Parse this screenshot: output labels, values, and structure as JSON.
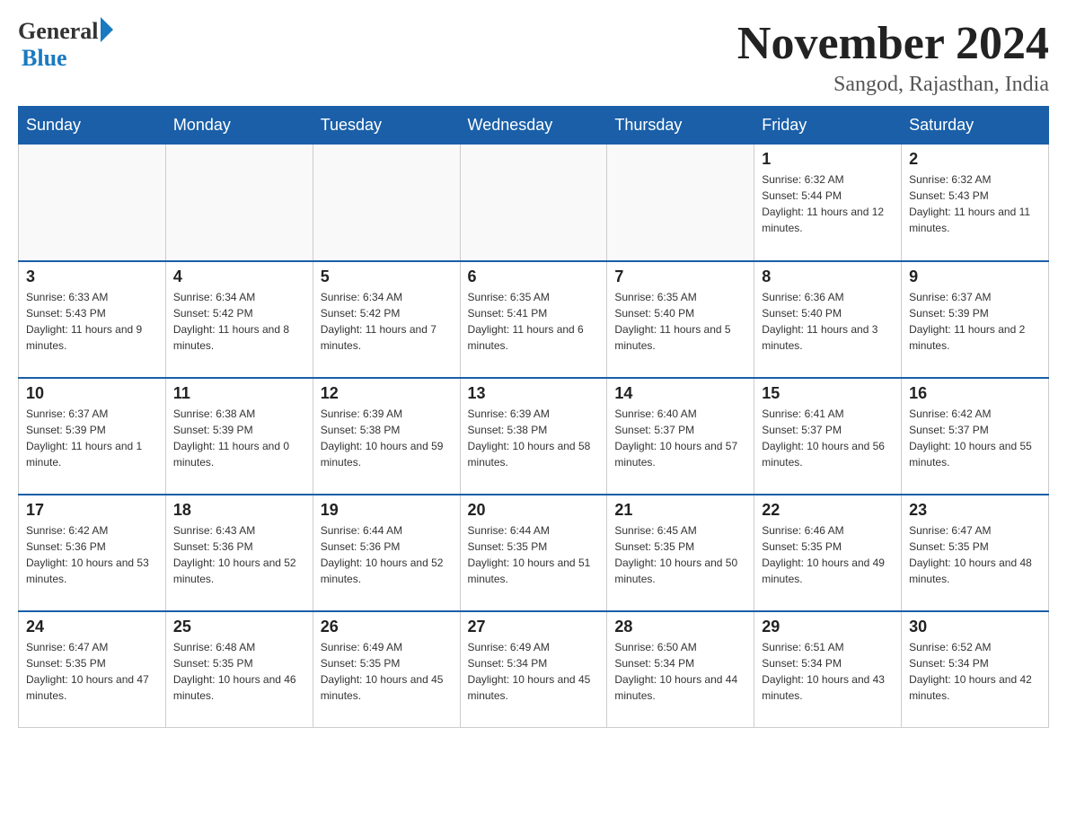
{
  "header": {
    "logo": {
      "general": "General",
      "blue": "Blue"
    },
    "title": "November 2024",
    "location": "Sangod, Rajasthan, India"
  },
  "days_of_week": [
    "Sunday",
    "Monday",
    "Tuesday",
    "Wednesday",
    "Thursday",
    "Friday",
    "Saturday"
  ],
  "weeks": [
    [
      {
        "day": "",
        "info": ""
      },
      {
        "day": "",
        "info": ""
      },
      {
        "day": "",
        "info": ""
      },
      {
        "day": "",
        "info": ""
      },
      {
        "day": "",
        "info": ""
      },
      {
        "day": "1",
        "info": "Sunrise: 6:32 AM\nSunset: 5:44 PM\nDaylight: 11 hours and 12 minutes."
      },
      {
        "day": "2",
        "info": "Sunrise: 6:32 AM\nSunset: 5:43 PM\nDaylight: 11 hours and 11 minutes."
      }
    ],
    [
      {
        "day": "3",
        "info": "Sunrise: 6:33 AM\nSunset: 5:43 PM\nDaylight: 11 hours and 9 minutes."
      },
      {
        "day": "4",
        "info": "Sunrise: 6:34 AM\nSunset: 5:42 PM\nDaylight: 11 hours and 8 minutes."
      },
      {
        "day": "5",
        "info": "Sunrise: 6:34 AM\nSunset: 5:42 PM\nDaylight: 11 hours and 7 minutes."
      },
      {
        "day": "6",
        "info": "Sunrise: 6:35 AM\nSunset: 5:41 PM\nDaylight: 11 hours and 6 minutes."
      },
      {
        "day": "7",
        "info": "Sunrise: 6:35 AM\nSunset: 5:40 PM\nDaylight: 11 hours and 5 minutes."
      },
      {
        "day": "8",
        "info": "Sunrise: 6:36 AM\nSunset: 5:40 PM\nDaylight: 11 hours and 3 minutes."
      },
      {
        "day": "9",
        "info": "Sunrise: 6:37 AM\nSunset: 5:39 PM\nDaylight: 11 hours and 2 minutes."
      }
    ],
    [
      {
        "day": "10",
        "info": "Sunrise: 6:37 AM\nSunset: 5:39 PM\nDaylight: 11 hours and 1 minute."
      },
      {
        "day": "11",
        "info": "Sunrise: 6:38 AM\nSunset: 5:39 PM\nDaylight: 11 hours and 0 minutes."
      },
      {
        "day": "12",
        "info": "Sunrise: 6:39 AM\nSunset: 5:38 PM\nDaylight: 10 hours and 59 minutes."
      },
      {
        "day": "13",
        "info": "Sunrise: 6:39 AM\nSunset: 5:38 PM\nDaylight: 10 hours and 58 minutes."
      },
      {
        "day": "14",
        "info": "Sunrise: 6:40 AM\nSunset: 5:37 PM\nDaylight: 10 hours and 57 minutes."
      },
      {
        "day": "15",
        "info": "Sunrise: 6:41 AM\nSunset: 5:37 PM\nDaylight: 10 hours and 56 minutes."
      },
      {
        "day": "16",
        "info": "Sunrise: 6:42 AM\nSunset: 5:37 PM\nDaylight: 10 hours and 55 minutes."
      }
    ],
    [
      {
        "day": "17",
        "info": "Sunrise: 6:42 AM\nSunset: 5:36 PM\nDaylight: 10 hours and 53 minutes."
      },
      {
        "day": "18",
        "info": "Sunrise: 6:43 AM\nSunset: 5:36 PM\nDaylight: 10 hours and 52 minutes."
      },
      {
        "day": "19",
        "info": "Sunrise: 6:44 AM\nSunset: 5:36 PM\nDaylight: 10 hours and 52 minutes."
      },
      {
        "day": "20",
        "info": "Sunrise: 6:44 AM\nSunset: 5:35 PM\nDaylight: 10 hours and 51 minutes."
      },
      {
        "day": "21",
        "info": "Sunrise: 6:45 AM\nSunset: 5:35 PM\nDaylight: 10 hours and 50 minutes."
      },
      {
        "day": "22",
        "info": "Sunrise: 6:46 AM\nSunset: 5:35 PM\nDaylight: 10 hours and 49 minutes."
      },
      {
        "day": "23",
        "info": "Sunrise: 6:47 AM\nSunset: 5:35 PM\nDaylight: 10 hours and 48 minutes."
      }
    ],
    [
      {
        "day": "24",
        "info": "Sunrise: 6:47 AM\nSunset: 5:35 PM\nDaylight: 10 hours and 47 minutes."
      },
      {
        "day": "25",
        "info": "Sunrise: 6:48 AM\nSunset: 5:35 PM\nDaylight: 10 hours and 46 minutes."
      },
      {
        "day": "26",
        "info": "Sunrise: 6:49 AM\nSunset: 5:35 PM\nDaylight: 10 hours and 45 minutes."
      },
      {
        "day": "27",
        "info": "Sunrise: 6:49 AM\nSunset: 5:34 PM\nDaylight: 10 hours and 45 minutes."
      },
      {
        "day": "28",
        "info": "Sunrise: 6:50 AM\nSunset: 5:34 PM\nDaylight: 10 hours and 44 minutes."
      },
      {
        "day": "29",
        "info": "Sunrise: 6:51 AM\nSunset: 5:34 PM\nDaylight: 10 hours and 43 minutes."
      },
      {
        "day": "30",
        "info": "Sunrise: 6:52 AM\nSunset: 5:34 PM\nDaylight: 10 hours and 42 minutes."
      }
    ]
  ]
}
